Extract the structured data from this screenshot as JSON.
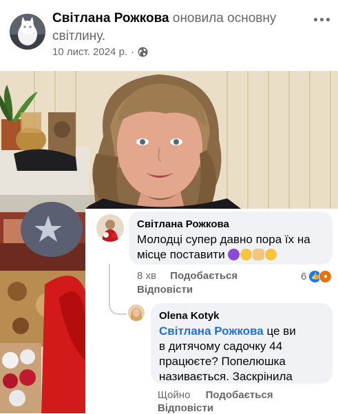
{
  "post": {
    "author": "Світлана Рожкова",
    "action": " оновила основну світлину.",
    "date": "10 лист. 2024 р.",
    "separator": "·",
    "privacy_icon": "globe-icon",
    "more_icon": "more-dots-icon"
  },
  "comments": [
    {
      "author": "Світлана Рожкова",
      "text": "Молодці супер давно пора їх на місце поставити",
      "emojis": [
        "smiling-imp-emoji",
        "grinning-sweat-emoji",
        "victory-hand-emoji",
        "tongue-out-emoji"
      ],
      "time": "8 хв",
      "like_label": "Подобається",
      "reply_label": "Відповісти",
      "reaction_count": "6",
      "reactions": [
        "like-reaction",
        "angry-reaction"
      ]
    },
    {
      "author": "Olena Kotyk",
      "mention": "Світлана Рожкова",
      "text": " це ви в дитячому садочку 44 працюєте? Попелюшка називається. Заскрінила",
      "time": "Щойно",
      "like_label": "Подобається",
      "reply_label": "Відповісти"
    }
  ],
  "colors": {
    "link": "#216fdb",
    "secondary_text": "#65676b",
    "bubble": "#f0f2f5",
    "like": "#1877f2",
    "angry": "#e9710f"
  }
}
